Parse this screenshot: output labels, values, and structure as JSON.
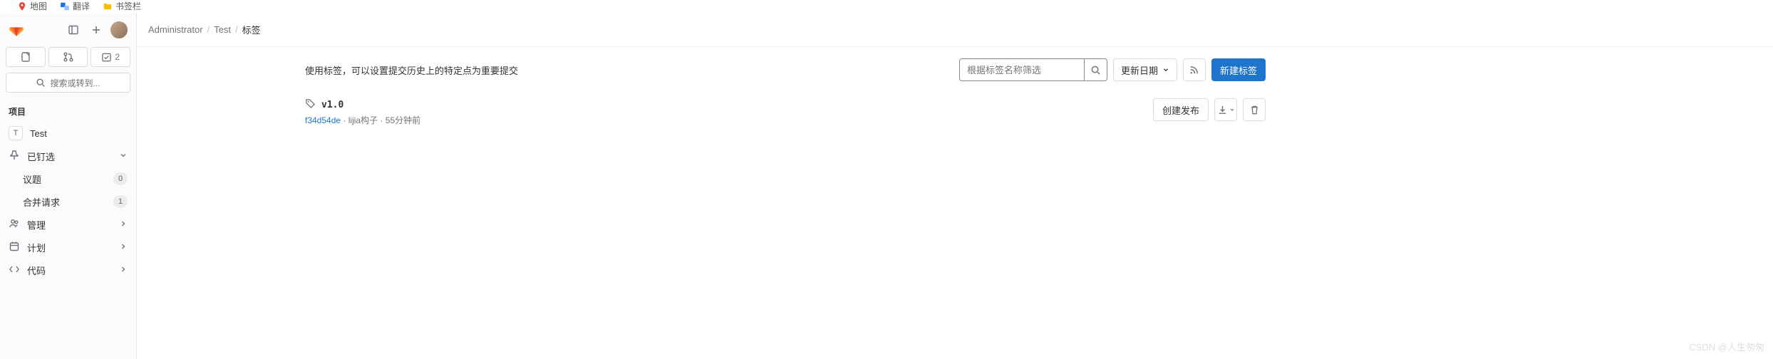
{
  "topbar": [
    {
      "label": "地图",
      "icon_color": "#4285f4"
    },
    {
      "label": "翻译",
      "icon_color": "#1a73e8"
    },
    {
      "label": "书签栏",
      "icon_color": "#fbbc04"
    }
  ],
  "header": {
    "search_placeholder": "搜索或转到..."
  },
  "action_badges": {
    "todo": "2"
  },
  "sidebar": {
    "section_label": "项目",
    "project": {
      "initial": "T",
      "name": "Test"
    },
    "pinned": {
      "label": "已钉选"
    },
    "items": [
      {
        "label": "议题",
        "badge": "0"
      },
      {
        "label": "合并请求",
        "badge": "1"
      }
    ],
    "nav": [
      {
        "label": "管理"
      },
      {
        "label": "计划"
      },
      {
        "label": "代码"
      }
    ]
  },
  "breadcrumb": {
    "parts": [
      "Administrator",
      "Test",
      "标签"
    ]
  },
  "toolbar": {
    "description": "使用标签，可以设置提交历史上的特定点为重要提交",
    "filter_placeholder": "根据标签名称筛选",
    "sort_label": "更新日期",
    "new_tag_label": "新建标签"
  },
  "tags": [
    {
      "name": "v1.0",
      "commit": "f34d54de",
      "author": "lijia构子",
      "time": "55分钟前",
      "create_release_label": "创建发布"
    }
  ],
  "watermark": "CSDN @人生匆匆"
}
